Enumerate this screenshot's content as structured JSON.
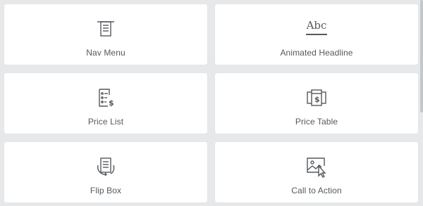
{
  "widgets": [
    {
      "label": "Nav Menu",
      "icon": "nav-menu-icon"
    },
    {
      "label": "Animated Headline",
      "icon": "animated-headline-icon",
      "glyph": "Abc"
    },
    {
      "label": "Price List",
      "icon": "price-list-icon"
    },
    {
      "label": "Price Table",
      "icon": "price-table-icon"
    },
    {
      "label": "Flip Box",
      "icon": "flip-box-icon"
    },
    {
      "label": "Call to Action",
      "icon": "call-to-action-icon"
    }
  ],
  "colors": {
    "background": "#e6e8ea",
    "card": "#ffffff",
    "text": "#55595c"
  }
}
